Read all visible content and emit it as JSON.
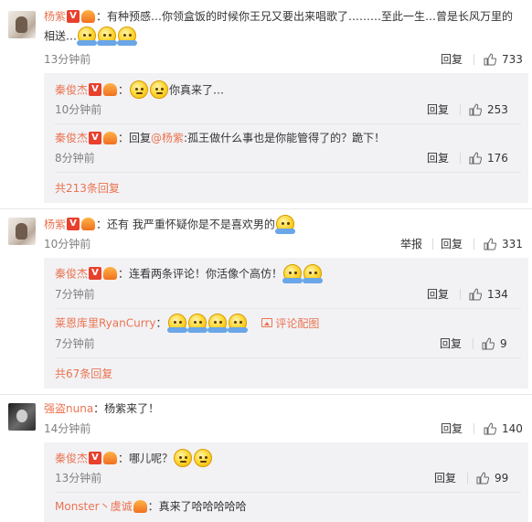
{
  "comments": [
    {
      "user": "杨紫",
      "text_a": "：有种预感…你领盒饭的时候你王兄又要出来唱歌了………至此一生…曾是长风万里的",
      "text_b": "相送…",
      "time": "13分钟前",
      "reply": "回复",
      "likes": "733",
      "subs": [
        {
          "user": "秦俊杰",
          "text": "你真来了…",
          "time": "10分钟前",
          "reply": "回复",
          "likes": "253"
        },
        {
          "user": "秦俊杰",
          "prefix": "：回复",
          "mention": "@杨紫",
          "text": ":孤王做什么事也是你能管得了的？跪下！",
          "time": "8分钟前",
          "reply": "回复",
          "likes": "176"
        }
      ],
      "more": "共213条回复"
    },
    {
      "user": "杨紫",
      "text": "：还有 我严重怀疑你是不是喜欢男的",
      "time": "10分钟前",
      "report": "举报",
      "reply": "回复",
      "likes": "331",
      "subs": [
        {
          "user": "秦俊杰",
          "text": "：连看两条评论！你活像个高仿！",
          "time": "7分钟前",
          "reply": "回复",
          "likes": "134"
        },
        {
          "user": "莱恩库里RyanCurry",
          "text": "：",
          "pic_link": "评论配图",
          "time": "7分钟前",
          "reply": "回复",
          "likes": "9"
        }
      ],
      "more": "共67条回复"
    },
    {
      "user": "强盗nuna",
      "text": "：杨紫来了！",
      "time": "14分钟前",
      "reply": "回复",
      "likes": "140",
      "subs": [
        {
          "user": "秦俊杰",
          "text": "：哪儿呢？",
          "time": "13分钟前",
          "reply": "回复",
          "likes": "99"
        },
        {
          "user": "Monster丶虞诚",
          "text": "：真来了哈哈哈哈哈"
        }
      ]
    }
  ],
  "badges": {
    "verified": "V",
    "verified_color": "#e8402c",
    "vip_color": "#f07020"
  },
  "colors": {
    "name": "#eb7350",
    "panel": "#f2f2f5",
    "time": "#808080"
  },
  "icons": {
    "like": "thumbs-up-icon",
    "emoji_hug": "hug-emoji-icon",
    "emoji_hmm": "hmm-emoji-icon",
    "picture": "picture-icon"
  }
}
